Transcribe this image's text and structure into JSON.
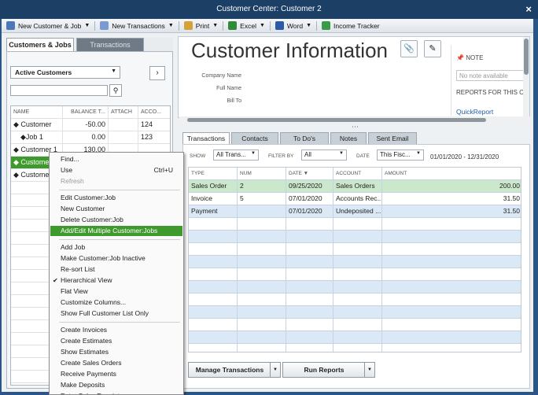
{
  "window": {
    "title": "Customer Center: Customer 2",
    "close_label": "×"
  },
  "toolbar": [
    {
      "label": "New Customer & Job",
      "icon": "new-customer-icon",
      "color": "#4a78b8",
      "dropdown": true
    },
    {
      "label": "New Transactions",
      "icon": "new-transactions-icon",
      "color": "#7a9ad0",
      "dropdown": true
    },
    {
      "label": "Print",
      "icon": "print-icon",
      "color": "#d4a23a",
      "dropdown": true
    },
    {
      "label": "Excel",
      "icon": "excel-icon",
      "color": "#2f8a3a",
      "dropdown": true
    },
    {
      "label": "Word",
      "icon": "word-icon",
      "color": "#2b5aa6",
      "dropdown": true
    },
    {
      "label": "Income Tracker",
      "icon": "income-tracker-icon",
      "color": "#3a9a4a",
      "dropdown": false
    }
  ],
  "left": {
    "tabs": [
      "Customers & Jobs",
      "Transactions"
    ],
    "filter": "Active Customers",
    "nav_arrow": "›",
    "search_placeholder": "",
    "columns": [
      "NAME",
      "BALANCE T...",
      "ATTACH",
      "ACCO..."
    ],
    "rows": [
      {
        "name": "◆ Customer",
        "balance": "-50.00",
        "attach": "",
        "account": "124"
      },
      {
        "name": "◆Job 1",
        "balance": "0.00",
        "attach": "",
        "account": "123"
      },
      {
        "name": "◆ Customer 1",
        "balance": "130.00",
        "attach": "",
        "account": ""
      },
      {
        "name": "◆ Customer 2",
        "balance": "",
        "attach": "",
        "account": ""
      },
      {
        "name": "◆ Customer 4",
        "balance": "",
        "attach": "",
        "account": ""
      }
    ]
  },
  "context_menu": [
    {
      "label": "Find...",
      "shortcut": ""
    },
    {
      "label": "Use",
      "shortcut": "Ctrl+U"
    },
    {
      "label": "Refresh",
      "shortcut": "",
      "disabled": true
    },
    {
      "sep": true
    },
    {
      "label": "Edit Customer:Job",
      "shortcut": ""
    },
    {
      "label": "New Customer",
      "shortcut": ""
    },
    {
      "label": "Delete Customer:Job",
      "shortcut": ""
    },
    {
      "label": "Add/Edit Multiple Customer:Jobs",
      "shortcut": "",
      "highlight": true
    },
    {
      "sep": true
    },
    {
      "label": "Add Job",
      "shortcut": ""
    },
    {
      "label": "Make Customer:Job Inactive",
      "shortcut": ""
    },
    {
      "label": "Re-sort List",
      "shortcut": ""
    },
    {
      "label": "Hierarchical View",
      "shortcut": "",
      "checked": true
    },
    {
      "label": "Flat View",
      "shortcut": ""
    },
    {
      "label": "Customize Columns...",
      "shortcut": ""
    },
    {
      "label": "Show Full Customer List Only",
      "shortcut": ""
    },
    {
      "sep": true
    },
    {
      "label": "Create Invoices",
      "shortcut": ""
    },
    {
      "label": "Create Estimates",
      "shortcut": ""
    },
    {
      "label": "Show Estimates",
      "shortcut": ""
    },
    {
      "label": "Create Sales Orders",
      "shortcut": ""
    },
    {
      "label": "Receive Payments",
      "shortcut": ""
    },
    {
      "label": "Make Deposits",
      "shortcut": ""
    },
    {
      "label": "Enter Sales Receipts",
      "shortcut": ""
    }
  ],
  "info": {
    "title": "Customer Information",
    "fields": [
      "Company Name",
      "Full Name",
      "Bill To"
    ],
    "note_label": "NOTE",
    "note_placeholder": "No note available",
    "reports_label": "REPORTS FOR THIS C",
    "quick_report": "QuickReport",
    "grip": "⋯"
  },
  "tabs": [
    "Transactions",
    "Contacts",
    "To Do's",
    "Notes",
    "Sent Email"
  ],
  "filters": {
    "show_label": "SHOW",
    "show_value": "All Trans...",
    "filter_label": "FILTER BY",
    "filter_value": "All",
    "date_label": "DATE",
    "date_value": "This Fisc...",
    "range": "01/01/2020 - 12/31/2020"
  },
  "transactions": {
    "columns": [
      "TYPE",
      "NUM",
      "DATE ▼",
      "ACCOUNT",
      "AMOUNT"
    ],
    "rows": [
      {
        "type": "Sales Order",
        "num": "2",
        "date": "09/25/2020",
        "account": "Sales Orders",
        "amount": "200.00"
      },
      {
        "type": "Invoice",
        "num": "5",
        "date": "07/01/2020",
        "account": "Accounts Rec...",
        "amount": "31.50"
      },
      {
        "type": "Payment",
        "num": "",
        "date": "07/01/2020",
        "account": "Undeposited ...",
        "amount": "31.50"
      }
    ]
  },
  "buttons": {
    "manage": "Manage Transactions",
    "run": "Run Reports"
  }
}
